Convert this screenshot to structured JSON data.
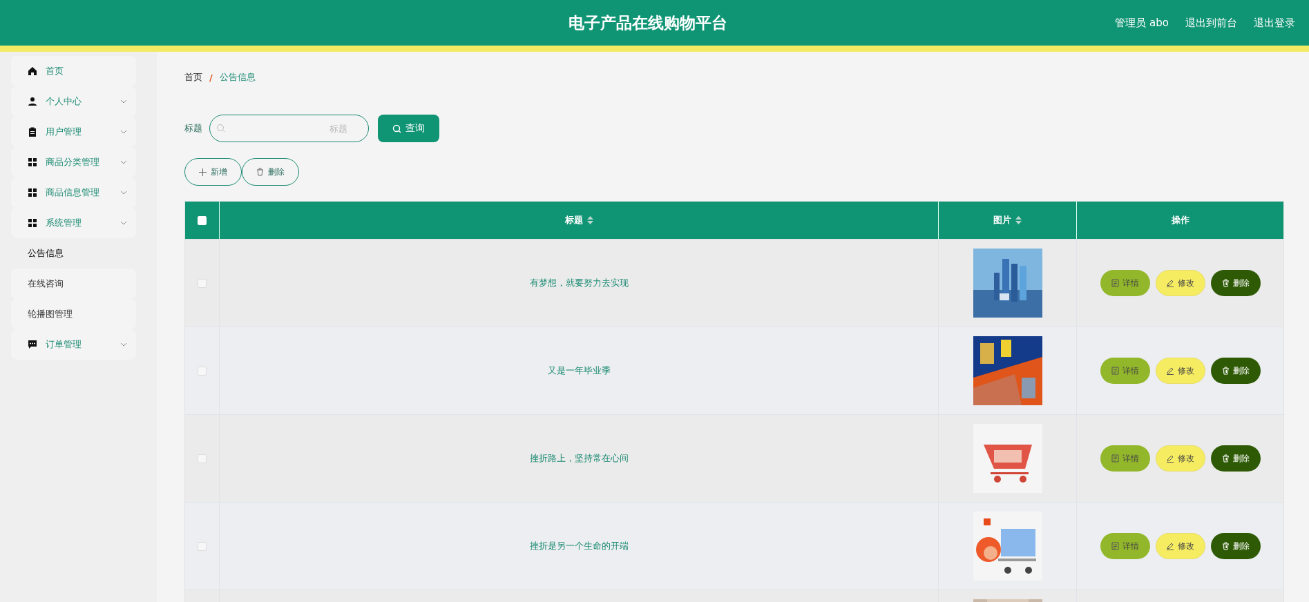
{
  "header": {
    "title": "电子产品在线购物平台",
    "links": [
      "管理员 abo",
      "退出到前台",
      "退出登录"
    ]
  },
  "sidebar": {
    "items": [
      {
        "label": "首页",
        "expandable": false
      },
      {
        "label": "个人中心",
        "expandable": true
      },
      {
        "label": "用户管理",
        "expandable": true
      },
      {
        "label": "商品分类管理",
        "expandable": true
      },
      {
        "label": "商品信息管理",
        "expandable": true
      },
      {
        "label": "系统管理",
        "expandable": true,
        "children": [
          {
            "label": "公告信息",
            "selected": true
          },
          {
            "label": "在线咨询",
            "selected": false
          },
          {
            "label": "轮播图管理",
            "selected": false
          }
        ]
      },
      {
        "label": "订单管理",
        "expandable": true
      }
    ]
  },
  "breadcrumb": [
    "首页",
    "/",
    "公告信息"
  ],
  "search": {
    "label": "标题",
    "placeholder": "标题",
    "button": "查询"
  },
  "actions": [
    "新增",
    "删除"
  ],
  "table": {
    "select_all": {
      "checked": false
    },
    "columns": [
      {
        "label": "标题",
        "sortable": true
      },
      {
        "label": "图片",
        "sortable": true
      },
      {
        "label": "操作",
        "sortable": false
      }
    ],
    "rows": [
      {
        "kind": "row",
        "title": "有梦想，就要努力去实现",
        "checked": false,
        "buttons": [
          {
            "kind": "detail",
            "label": "详情"
          },
          {
            "kind": "edit",
            "label": "修改"
          },
          {
            "kind": "delete",
            "label": "删除"
          }
        ]
      },
      {
        "kind": "row",
        "title": "又是一年毕业季",
        "checked": false,
        "buttons": [
          {
            "kind": "detail",
            "label": "详情"
          },
          {
            "kind": "edit",
            "label": "修改"
          },
          {
            "kind": "delete",
            "label": "删除"
          }
        ]
      },
      {
        "kind": "row",
        "title": "挫折路上，坚持常在心间",
        "checked": false,
        "buttons": [
          {
            "kind": "detail",
            "label": "详情"
          },
          {
            "kind": "edit",
            "label": "修改"
          },
          {
            "kind": "delete",
            "label": "删除"
          }
        ]
      },
      {
        "kind": "row",
        "title": "挫折是另一个生命的开端",
        "checked": false,
        "buttons": [
          {
            "kind": "detail",
            "label": "详情"
          },
          {
            "kind": "edit",
            "label": "修改"
          },
          {
            "kind": "delete",
            "label": "删除"
          }
        ]
      },
      {
        "kind": "cut"
      }
    ]
  }
}
